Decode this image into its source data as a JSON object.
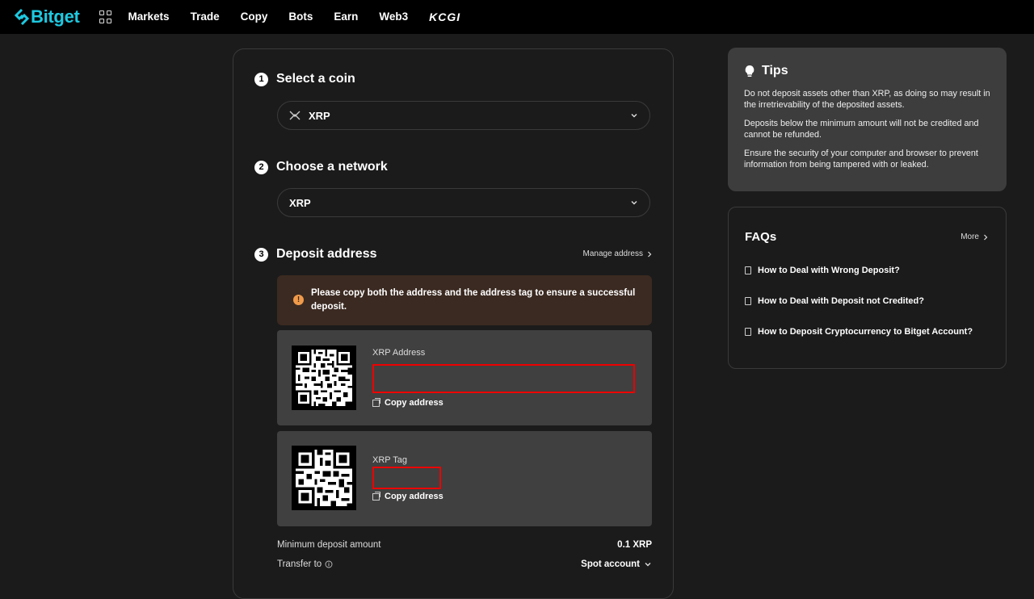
{
  "header": {
    "logo_text": "Bitget",
    "nav": [
      "Markets",
      "Trade",
      "Copy",
      "Bots",
      "Earn",
      "Web3"
    ],
    "brand_extra": "KCGI"
  },
  "steps": {
    "step1": {
      "num": "1",
      "title": "Select a coin",
      "value": "XRP"
    },
    "step2": {
      "num": "2",
      "title": "Choose a network",
      "value": "XRP"
    },
    "step3": {
      "num": "3",
      "title": "Deposit address",
      "manage": "Manage address"
    }
  },
  "warning": "Please copy both the address and the address tag to ensure a successful deposit.",
  "address_box": {
    "label": "XRP Address",
    "copy": "Copy address"
  },
  "tag_box": {
    "label": "XRP Tag",
    "copy": "Copy address"
  },
  "details": {
    "min_label": "Minimum deposit amount",
    "min_value": "0.1 XRP",
    "transfer_label": "Transfer to",
    "transfer_value": "Spot account"
  },
  "tips": {
    "title": "Tips",
    "items": [
      "Do not deposit assets other than XRP, as doing so may result in the irretrievability of the deposited assets.",
      "Deposits below the minimum amount will not be credited and cannot be refunded.",
      "Ensure the security of your computer and browser to prevent information from being tampered with or leaked."
    ]
  },
  "faqs": {
    "title": "FAQs",
    "more": "More",
    "items": [
      "How to Deal with Wrong Deposit?",
      "How to Deal with Deposit not Credited?",
      "How to Deposit Cryptocurrency to Bitget Account?"
    ]
  },
  "colors": {
    "brand": "#1ec9e0",
    "highlight": "#e00000",
    "warning_bg": "#3b2a21"
  }
}
